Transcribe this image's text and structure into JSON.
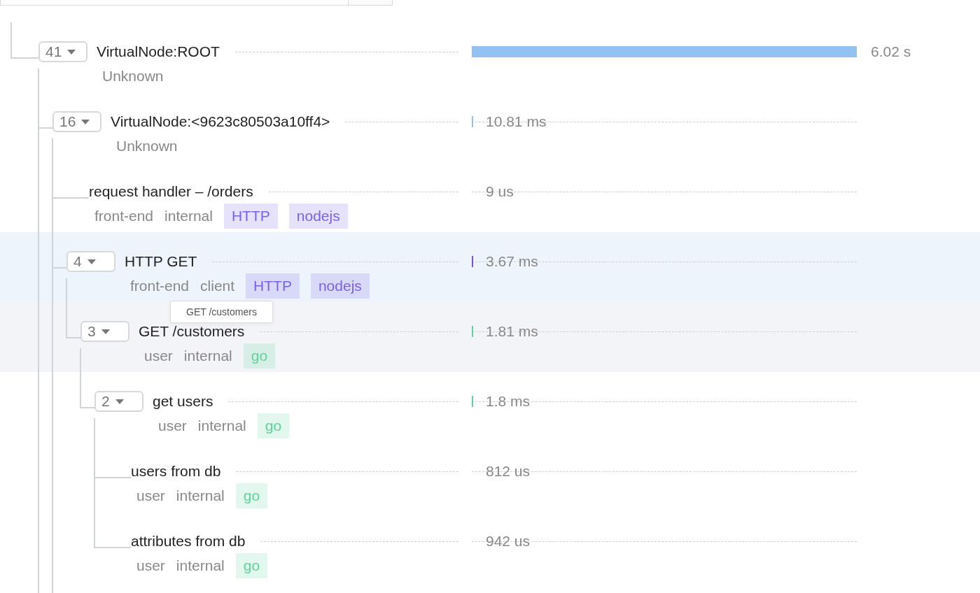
{
  "spans": [
    {
      "title": "VirtualNode:ROOT",
      "count": "41",
      "expanded": true,
      "more_children": true,
      "selected": false,
      "hovered": false,
      "tags": [
        {
          "text": "Unknown",
          "kind": "plain"
        }
      ],
      "duration": "6.02 s",
      "level": 1,
      "color": "#93c2f2",
      "children": [
        {
          "title": "VirtualNode:<9623c80503a10ff4>",
          "count": "16",
          "expanded": true,
          "more_children": true,
          "selected": false,
          "hovered": false,
          "tags": [
            {
              "text": "Unknown",
              "kind": "plain"
            }
          ],
          "duration": "10.81 ms",
          "color": "#93c2f2",
          "children": [
            {
              "title": "request handler – /orders",
              "selected": false,
              "hovered": false,
              "tags": [
                {
                  "text": "front-end",
                  "kind": "plain"
                },
                {
                  "text": "internal",
                  "kind": "plain"
                },
                {
                  "text": "HTTP",
                  "kind": "label",
                  "color": "#7b61e8"
                },
                {
                  "text": "nodejs",
                  "kind": "label",
                  "color": "#7b61e8"
                }
              ],
              "duration": "9 us"
            },
            {
              "title": "HTTP GET",
              "count": "4",
              "expanded": true,
              "more_children": false,
              "selected": false,
              "hovered": true,
              "tooltip": "GET /customers",
              "tags": [
                {
                  "text": "front-end",
                  "kind": "plain"
                },
                {
                  "text": "client",
                  "kind": "plain"
                },
                {
                  "text": "HTTP",
                  "kind": "label",
                  "color": "#7b61e8"
                },
                {
                  "text": "nodejs",
                  "kind": "label",
                  "color": "#7b61e8"
                }
              ],
              "duration": "3.67 ms",
              "color": "#7b4fe0",
              "children": [
                {
                  "title": "GET /customers",
                  "count": "3",
                  "expanded": true,
                  "more_children": false,
                  "selected": true,
                  "hovered": false,
                  "tags": [
                    {
                      "text": "user",
                      "kind": "plain"
                    },
                    {
                      "text": "internal",
                      "kind": "plain"
                    },
                    {
                      "text": "go",
                      "kind": "label",
                      "color": "#5fd49a"
                    }
                  ],
                  "duration": "1.81 ms",
                  "color": "#5fd49a",
                  "children": [
                    {
                      "title": "get users",
                      "count": "2",
                      "expanded": true,
                      "more_children": false,
                      "selected": false,
                      "hovered": false,
                      "tags": [
                        {
                          "text": "user",
                          "kind": "plain"
                        },
                        {
                          "text": "internal",
                          "kind": "plain"
                        },
                        {
                          "text": "go",
                          "kind": "label",
                          "color": "#5fd49a"
                        }
                      ],
                      "duration": "1.8 ms",
                      "color": "#5fd49a",
                      "children": [
                        {
                          "title": "users from db",
                          "selected": false,
                          "hovered": false,
                          "tags": [
                            {
                              "text": "user",
                              "kind": "plain"
                            },
                            {
                              "text": "internal",
                              "kind": "plain"
                            },
                            {
                              "text": "go",
                              "kind": "label",
                              "color": "#5fd49a"
                            }
                          ],
                          "duration": "812 us"
                        },
                        {
                          "title": "attributes from db",
                          "selected": false,
                          "hovered": false,
                          "tags": [
                            {
                              "text": "user",
                              "kind": "plain"
                            },
                            {
                              "text": "internal",
                              "kind": "plain"
                            },
                            {
                              "text": "go",
                              "kind": "label",
                              "color": "#5fd49a"
                            }
                          ],
                          "duration": "942 us"
                        }
                      ]
                    }
                  ]
                }
              ]
            }
          ]
        }
      ]
    }
  ]
}
